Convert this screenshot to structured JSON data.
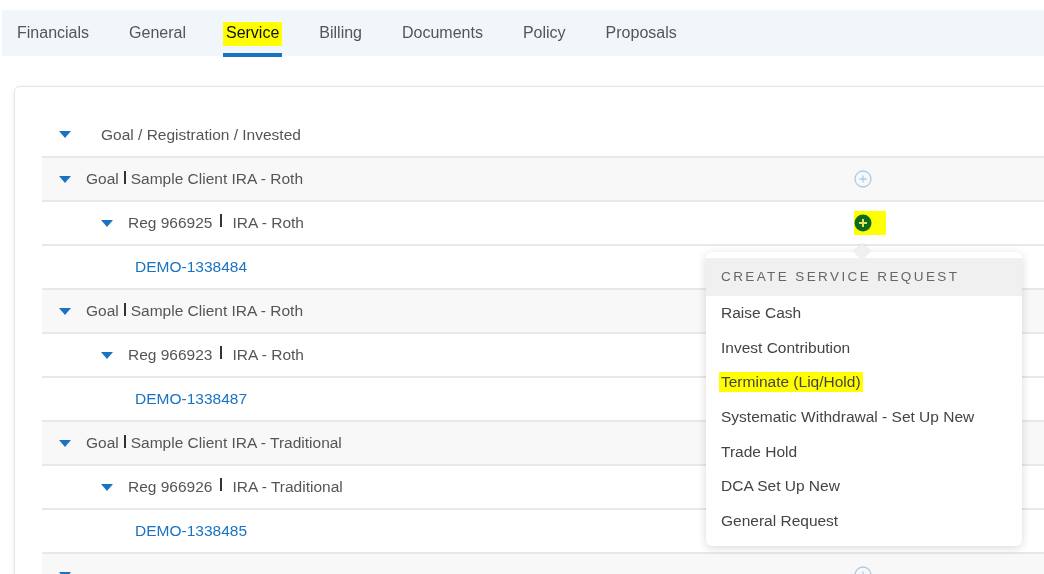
{
  "tabs": [
    {
      "label": "Financials",
      "selected": false,
      "highlighted": false
    },
    {
      "label": "General",
      "selected": false,
      "highlighted": false
    },
    {
      "label": "Service",
      "selected": true,
      "highlighted": true
    },
    {
      "label": "Billing",
      "selected": false,
      "highlighted": false
    },
    {
      "label": "Documents",
      "selected": false,
      "highlighted": false
    },
    {
      "label": "Policy",
      "selected": false,
      "highlighted": false
    },
    {
      "label": "Proposals",
      "selected": false,
      "highlighted": false
    }
  ],
  "tree": {
    "header": {
      "label": "Goal / Registration / Invested",
      "expanded": true
    },
    "goals": [
      {
        "prefix": "Goal",
        "name": "Sample Client IRA - Roth",
        "expanded": true,
        "add_active": false,
        "children": [
          {
            "prefix": "Reg 966925",
            "name": "IRA - Roth",
            "expanded": true,
            "add_active": true,
            "highlighted": true,
            "children": [
              {
                "account": "DEMO-1338484"
              }
            ]
          }
        ]
      },
      {
        "prefix": "Goal",
        "name": "Sample Client IRA - Roth",
        "expanded": true,
        "children": [
          {
            "prefix": "Reg 966923",
            "name": "IRA - Roth",
            "expanded": true,
            "children": [
              {
                "account": "DEMO-1338487"
              }
            ]
          }
        ]
      },
      {
        "prefix": "Goal",
        "name": "Sample Client IRA - Traditional",
        "expanded": true,
        "children": [
          {
            "prefix": "Reg 966926",
            "name": "IRA - Traditional",
            "expanded": true,
            "children": [
              {
                "account": "DEMO-1338485"
              }
            ]
          }
        ]
      },
      {
        "expanded": true,
        "add_active": false
      }
    ]
  },
  "menu": {
    "title": "CREATE SERVICE REQUEST",
    "items": [
      {
        "label": "Raise Cash",
        "highlighted": false
      },
      {
        "label": "Invest Contribution",
        "highlighted": false
      },
      {
        "label": "Terminate (Liq/Hold)",
        "highlighted": true
      },
      {
        "label": "Systematic Withdrawal - Set Up New",
        "highlighted": false
      },
      {
        "label": "Trade Hold",
        "highlighted": false
      },
      {
        "label": "DCA Set Up New",
        "highlighted": false
      },
      {
        "label": "General Request",
        "highlighted": false
      }
    ]
  }
}
